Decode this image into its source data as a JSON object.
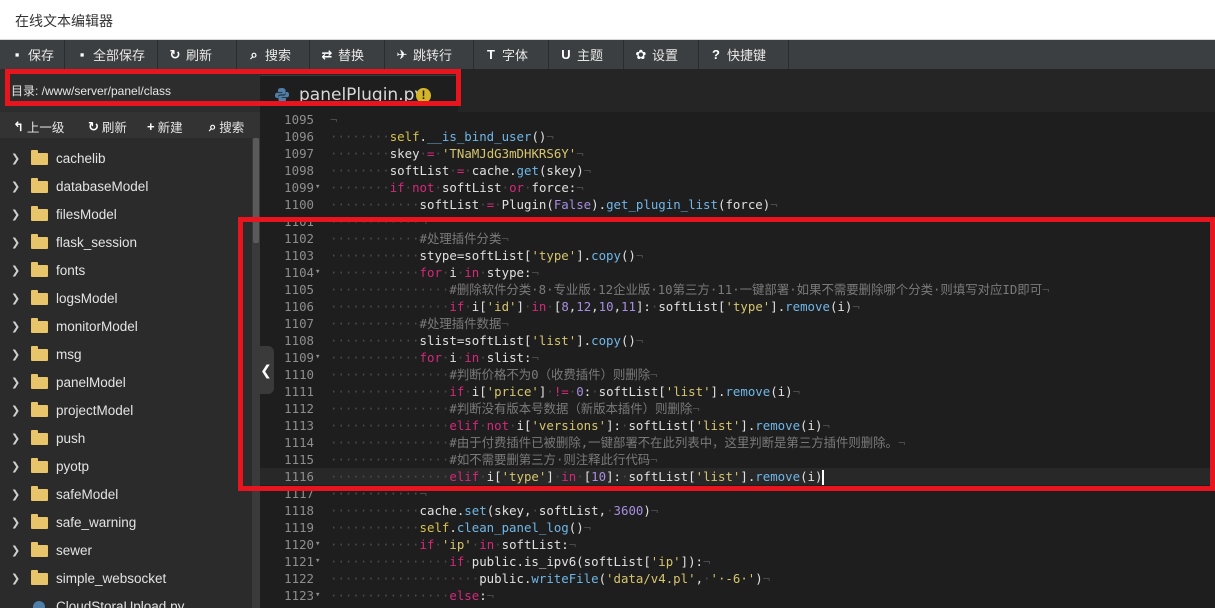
{
  "window": {
    "title": "在线文本编辑器"
  },
  "toolbar": [
    {
      "label": "保存",
      "icon": "save-icon",
      "glyph": "▪",
      "w": 65
    },
    {
      "label": "全部保存",
      "icon": "save-all-icon",
      "glyph": "▪",
      "w": 93
    },
    {
      "label": "刷新",
      "icon": "refresh-icon",
      "glyph": "↻",
      "w": 79
    },
    {
      "label": "搜索",
      "icon": "search-icon",
      "glyph": "⌕",
      "w": 73
    },
    {
      "label": "替换",
      "icon": "replace-icon",
      "glyph": "⇄",
      "w": 75
    },
    {
      "label": "跳转行",
      "icon": "goto-line-icon",
      "glyph": "✈",
      "w": 89
    },
    {
      "label": "字体",
      "icon": "font-icon",
      "glyph": "T",
      "w": 75
    },
    {
      "label": "主题",
      "icon": "theme-icon",
      "glyph": "U",
      "w": 75
    },
    {
      "label": "设置",
      "icon": "settings-icon",
      "glyph": "✿",
      "w": 75
    },
    {
      "label": "快捷键",
      "icon": "shortcut-icon",
      "glyph": "?",
      "w": 90
    }
  ],
  "directory": {
    "label": "目录: /www/server/panel/class"
  },
  "tab": {
    "filename": "panelPlugin.py",
    "warning": "!"
  },
  "sidebar": {
    "tools": [
      {
        "label": "上一级",
        "icon": "up-level-icon",
        "glyph": "↰"
      },
      {
        "label": "刷新",
        "icon": "refresh-icon",
        "glyph": "↻"
      },
      {
        "label": "新建",
        "icon": "plus-icon",
        "glyph": "+"
      },
      {
        "label": "搜索",
        "icon": "search-icon",
        "glyph": "⌕"
      }
    ],
    "items": [
      "cachelib",
      "databaseModel",
      "filesModel",
      "flask_session",
      "fonts",
      "logsModel",
      "monitorModel",
      "msg",
      "panelModel",
      "projectModel",
      "push",
      "pyotp",
      "safeModel",
      "safe_warning",
      "sewer",
      "simple_websocket"
    ],
    "file_item": "CloudStoraUpload.py"
  },
  "editor": {
    "lines": [
      {
        "n": "1095",
        "f": "",
        "segs": [
          [
            "ws",
            "¬"
          ]
        ]
      },
      {
        "n": "1096",
        "f": "",
        "segs": [
          [
            "ws",
            "········"
          ],
          [
            "self",
            "self"
          ],
          [
            "pl",
            "."
          ],
          [
            "fn",
            "__is_bind_user"
          ],
          [
            "pl",
            "()"
          ],
          [
            "ws",
            "¬"
          ]
        ]
      },
      {
        "n": "1097",
        "f": "",
        "segs": [
          [
            "ws",
            "········"
          ],
          [
            "pl",
            "skey"
          ],
          [
            "ws",
            "·"
          ],
          [
            "kw",
            "="
          ],
          [
            "ws",
            "·"
          ],
          [
            "str",
            "'TNaMJdG3mDHKRS6Y'"
          ],
          [
            "ws",
            "¬"
          ]
        ]
      },
      {
        "n": "1098",
        "f": "",
        "segs": [
          [
            "ws",
            "········"
          ],
          [
            "pl",
            "softList"
          ],
          [
            "ws",
            "·"
          ],
          [
            "kw",
            "="
          ],
          [
            "ws",
            "·"
          ],
          [
            "pl",
            "cache."
          ],
          [
            "fn",
            "get"
          ],
          [
            "pl",
            "(skey)"
          ],
          [
            "ws",
            "¬"
          ]
        ]
      },
      {
        "n": "1099",
        "f": "▾",
        "segs": [
          [
            "ws",
            "········"
          ],
          [
            "kw",
            "if"
          ],
          [
            "ws",
            "·"
          ],
          [
            "kw",
            "not"
          ],
          [
            "ws",
            "·"
          ],
          [
            "pl",
            "softList"
          ],
          [
            "ws",
            "·"
          ],
          [
            "kw",
            "or"
          ],
          [
            "ws",
            "·"
          ],
          [
            "pl",
            "force:"
          ],
          [
            "ws",
            "¬"
          ]
        ]
      },
      {
        "n": "1100",
        "f": "",
        "segs": [
          [
            "ws",
            "············"
          ],
          [
            "pl",
            "softList"
          ],
          [
            "ws",
            "·"
          ],
          [
            "kw",
            "="
          ],
          [
            "ws",
            "·"
          ],
          [
            "pl",
            "Plugin("
          ],
          [
            "num",
            "False"
          ],
          [
            "pl",
            ")."
          ],
          [
            "fn",
            "get_plugin_list"
          ],
          [
            "pl",
            "(force)"
          ],
          [
            "ws",
            "¬"
          ]
        ]
      },
      {
        "n": "1101",
        "f": "",
        "segs": [
          [
            "ws",
            "············¬"
          ]
        ]
      },
      {
        "n": "1102",
        "f": "",
        "segs": [
          [
            "ws",
            "············"
          ],
          [
            "cm",
            "#处理插件分类"
          ],
          [
            "ws",
            "¬"
          ]
        ]
      },
      {
        "n": "1103",
        "f": "",
        "segs": [
          [
            "ws",
            "············"
          ],
          [
            "pl",
            "stype=softList["
          ],
          [
            "str",
            "'type'"
          ],
          [
            "pl",
            "]."
          ],
          [
            "fn",
            "copy"
          ],
          [
            "pl",
            "()"
          ],
          [
            "ws",
            "¬"
          ]
        ]
      },
      {
        "n": "1104",
        "f": "▾",
        "segs": [
          [
            "ws",
            "············"
          ],
          [
            "kw",
            "for"
          ],
          [
            "ws",
            "·"
          ],
          [
            "pl",
            "i"
          ],
          [
            "ws",
            "·"
          ],
          [
            "kw",
            "in"
          ],
          [
            "ws",
            "·"
          ],
          [
            "pl",
            "stype:"
          ],
          [
            "ws",
            "¬"
          ]
        ]
      },
      {
        "n": "1105",
        "f": "",
        "segs": [
          [
            "ws",
            "················"
          ],
          [
            "cm",
            "#删除软件分类·8·专业版·12企业版·10第三方·11·一键部署·如果不需要删除哪个分类·则填写对应ID即可"
          ],
          [
            "ws",
            "¬"
          ]
        ]
      },
      {
        "n": "1106",
        "f": "",
        "segs": [
          [
            "ws",
            "················"
          ],
          [
            "kw",
            "if"
          ],
          [
            "ws",
            "·"
          ],
          [
            "pl",
            "i["
          ],
          [
            "str",
            "'id'"
          ],
          [
            "pl",
            "]"
          ],
          [
            "ws",
            "·"
          ],
          [
            "kw",
            "in"
          ],
          [
            "ws",
            "·"
          ],
          [
            "pl",
            "["
          ],
          [
            "num",
            "8"
          ],
          [
            "pl",
            ","
          ],
          [
            "num",
            "12"
          ],
          [
            "pl",
            ","
          ],
          [
            "num",
            "10"
          ],
          [
            "pl",
            ","
          ],
          [
            "num",
            "11"
          ],
          [
            "pl",
            "]:"
          ],
          [
            "ws",
            "·"
          ],
          [
            "pl",
            "softList["
          ],
          [
            "str",
            "'type'"
          ],
          [
            "pl",
            "]."
          ],
          [
            "fn",
            "remove"
          ],
          [
            "pl",
            "(i)"
          ],
          [
            "ws",
            "¬"
          ]
        ]
      },
      {
        "n": "1107",
        "f": "",
        "segs": [
          [
            "ws",
            "············"
          ],
          [
            "cm",
            "#处理插件数据"
          ],
          [
            "ws",
            "¬"
          ]
        ]
      },
      {
        "n": "1108",
        "f": "",
        "segs": [
          [
            "ws",
            "············"
          ],
          [
            "pl",
            "slist=softList["
          ],
          [
            "str",
            "'list'"
          ],
          [
            "pl",
            "]."
          ],
          [
            "fn",
            "copy"
          ],
          [
            "pl",
            "()"
          ],
          [
            "ws",
            "¬"
          ]
        ]
      },
      {
        "n": "1109",
        "f": "▾",
        "segs": [
          [
            "ws",
            "············"
          ],
          [
            "kw",
            "for"
          ],
          [
            "ws",
            "·"
          ],
          [
            "pl",
            "i"
          ],
          [
            "ws",
            "·"
          ],
          [
            "kw",
            "in"
          ],
          [
            "ws",
            "·"
          ],
          [
            "pl",
            "slist:"
          ],
          [
            "ws",
            "¬"
          ]
        ]
      },
      {
        "n": "1110",
        "f": "",
        "segs": [
          [
            "ws",
            "················"
          ],
          [
            "cm",
            "#判断价格不为0（收费插件）则删除"
          ],
          [
            "ws",
            "¬"
          ]
        ]
      },
      {
        "n": "1111",
        "f": "",
        "segs": [
          [
            "ws",
            "················"
          ],
          [
            "kw",
            "if"
          ],
          [
            "ws",
            "·"
          ],
          [
            "pl",
            "i["
          ],
          [
            "str",
            "'price'"
          ],
          [
            "pl",
            "]"
          ],
          [
            "ws",
            "·"
          ],
          [
            "kw",
            "!="
          ],
          [
            "ws",
            "·"
          ],
          [
            "num",
            "0"
          ],
          [
            "pl",
            ":"
          ],
          [
            "ws",
            "·"
          ],
          [
            "pl",
            "softList["
          ],
          [
            "str",
            "'list'"
          ],
          [
            "pl",
            "]."
          ],
          [
            "fn",
            "remove"
          ],
          [
            "pl",
            "(i)"
          ],
          [
            "ws",
            "¬"
          ]
        ]
      },
      {
        "n": "1112",
        "f": "",
        "segs": [
          [
            "ws",
            "················"
          ],
          [
            "cm",
            "#判断没有版本号数据（新版本插件）则删除"
          ],
          [
            "ws",
            "¬"
          ]
        ]
      },
      {
        "n": "1113",
        "f": "",
        "segs": [
          [
            "ws",
            "················"
          ],
          [
            "kw",
            "elif"
          ],
          [
            "ws",
            "·"
          ],
          [
            "kw",
            "not"
          ],
          [
            "ws",
            "·"
          ],
          [
            "pl",
            "i["
          ],
          [
            "str",
            "'versions'"
          ],
          [
            "pl",
            "]:"
          ],
          [
            "ws",
            "·"
          ],
          [
            "pl",
            "softList["
          ],
          [
            "str",
            "'list'"
          ],
          [
            "pl",
            "]."
          ],
          [
            "fn",
            "remove"
          ],
          [
            "pl",
            "(i)"
          ],
          [
            "ws",
            "¬"
          ]
        ]
      },
      {
        "n": "1114",
        "f": "",
        "segs": [
          [
            "ws",
            "················"
          ],
          [
            "cm",
            "#由于付费插件已被删除,一键部署不在此列表中，这里判断是第三方插件则删除。"
          ],
          [
            "ws",
            "¬"
          ]
        ]
      },
      {
        "n": "1115",
        "f": "",
        "segs": [
          [
            "ws",
            "················"
          ],
          [
            "cm",
            "#如不需要删第三方·则注释此行代码"
          ],
          [
            "ws",
            "¬"
          ]
        ]
      },
      {
        "n": "1116",
        "f": "",
        "active": true,
        "segs": [
          [
            "ws",
            "················"
          ],
          [
            "kw",
            "elif"
          ],
          [
            "ws",
            "·"
          ],
          [
            "pl",
            "i["
          ],
          [
            "str",
            "'type'"
          ],
          [
            "pl",
            "]"
          ],
          [
            "ws",
            "·"
          ],
          [
            "kw",
            "in"
          ],
          [
            "ws",
            "·"
          ],
          [
            "pl",
            "["
          ],
          [
            "num",
            "10"
          ],
          [
            "pl",
            "]:"
          ],
          [
            "ws",
            "·"
          ],
          [
            "pl",
            "softList["
          ],
          [
            "str",
            "'list'"
          ],
          [
            "pl",
            "]."
          ],
          [
            "fn",
            "remove"
          ],
          [
            "pl",
            "(i)"
          ],
          [
            "cursor",
            ""
          ]
        ]
      },
      {
        "n": "1117",
        "f": "",
        "segs": [
          [
            "ws",
            "············¬"
          ]
        ]
      },
      {
        "n": "1118",
        "f": "",
        "segs": [
          [
            "ws",
            "············"
          ],
          [
            "pl",
            "cache."
          ],
          [
            "fn",
            "set"
          ],
          [
            "pl",
            "(skey,"
          ],
          [
            "ws",
            "·"
          ],
          [
            "pl",
            "softList,"
          ],
          [
            "ws",
            "·"
          ],
          [
            "num",
            "3600"
          ],
          [
            "pl",
            ")"
          ],
          [
            "ws",
            "¬"
          ]
        ]
      },
      {
        "n": "1119",
        "f": "",
        "segs": [
          [
            "ws",
            "············"
          ],
          [
            "self",
            "self"
          ],
          [
            "pl",
            "."
          ],
          [
            "fn",
            "clean_panel_log"
          ],
          [
            "pl",
            "()"
          ],
          [
            "ws",
            "¬"
          ]
        ]
      },
      {
        "n": "1120",
        "f": "▾",
        "segs": [
          [
            "ws",
            "············"
          ],
          [
            "kw",
            "if"
          ],
          [
            "ws",
            "·"
          ],
          [
            "str",
            "'ip'"
          ],
          [
            "ws",
            "·"
          ],
          [
            "kw",
            "in"
          ],
          [
            "ws",
            "·"
          ],
          [
            "pl",
            "softList:"
          ],
          [
            "ws",
            "¬"
          ]
        ]
      },
      {
        "n": "1121",
        "f": "▾",
        "segs": [
          [
            "ws",
            "················"
          ],
          [
            "kw",
            "if"
          ],
          [
            "ws",
            "·"
          ],
          [
            "pl",
            "public.is_ipv6(softList["
          ],
          [
            "str",
            "'ip'"
          ],
          [
            "pl",
            "]):"
          ],
          [
            "ws",
            "¬"
          ]
        ]
      },
      {
        "n": "1122",
        "f": "",
        "segs": [
          [
            "ws",
            "····················"
          ],
          [
            "pl",
            "public."
          ],
          [
            "fn",
            "writeFile"
          ],
          [
            "pl",
            "("
          ],
          [
            "str",
            "'data/v4.pl'"
          ],
          [
            "pl",
            ","
          ],
          [
            "ws",
            "·"
          ],
          [
            "str",
            "'·-6·'"
          ],
          [
            "pl",
            ")"
          ],
          [
            "ws",
            "¬"
          ]
        ]
      },
      {
        "n": "1123",
        "f": "▾",
        "segs": [
          [
            "ws",
            "················"
          ],
          [
            "kw",
            "else"
          ],
          [
            "pl",
            ":"
          ],
          [
            "ws",
            "¬"
          ]
        ]
      }
    ]
  }
}
